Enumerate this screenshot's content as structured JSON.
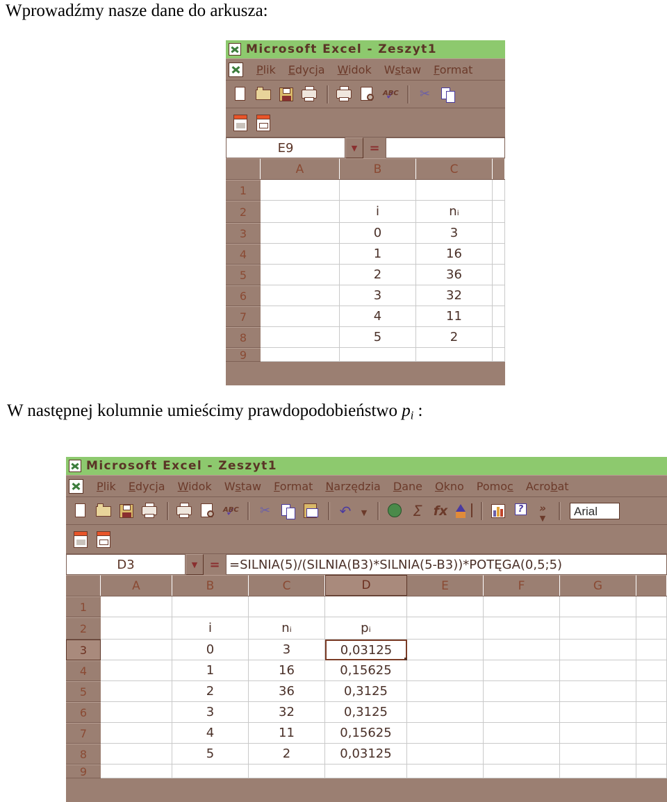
{
  "document": {
    "intro_text_before": "Wprowadźmy nasze dane do arkusza:",
    "second_text_before": "W następnej kolumnie umieścimy prawdopodobieństwo ",
    "second_text_symbol": "p",
    "second_text_symbol_sub": "i",
    "second_text_after": " :"
  },
  "colors": {
    "titlebar": "#8dc96e",
    "chrome": "#9b7f72",
    "chrome_dark": "#7d6055",
    "chrome_light": "#b79e92",
    "header_text": "#8a4a33",
    "cell_text": "#4a3028",
    "selection": "#7a3b26"
  },
  "window1": {
    "title": "Microsoft Excel - Zeszyt1",
    "logo_icon": "excel-logo-icon",
    "menu": [
      "Plik",
      "Edycja",
      "Widok",
      "Wstaw",
      "Format"
    ],
    "toolbar_icons": [
      "new-document-icon",
      "open-folder-icon",
      "save-disk-icon",
      "print-to-file-icon",
      "print-icon",
      "print-preview-icon",
      "spellcheck-icon",
      "cut-scissors-icon",
      "copy-icon"
    ],
    "toolbar2_icons": [
      "pdf-convert-icon",
      "pdf-settings-icon"
    ],
    "name_box": "E9",
    "equals_sign": "=",
    "formula": "",
    "dropdown_icon": "chevron-down-icon",
    "columns": [
      "A",
      "B",
      "C"
    ],
    "rows": [
      "1",
      "2",
      "3",
      "4",
      "5",
      "6",
      "7",
      "8",
      "9"
    ],
    "grid": [
      [
        "",
        "",
        ""
      ],
      [
        "",
        "i",
        "nᵢ"
      ],
      [
        "",
        "0",
        "3"
      ],
      [
        "",
        "1",
        "16"
      ],
      [
        "",
        "2",
        "36"
      ],
      [
        "",
        "3",
        "32"
      ],
      [
        "",
        "4",
        "11"
      ],
      [
        "",
        "5",
        "2"
      ],
      [
        "",
        "",
        ""
      ]
    ]
  },
  "window2": {
    "title": "Microsoft Excel - Zeszyt1",
    "logo_icon": "excel-logo-icon",
    "menu": [
      "Plik",
      "Edycja",
      "Widok",
      "Wstaw",
      "Format",
      "Narzędzia",
      "Dane",
      "Okno",
      "Pomoc",
      "Acrobat"
    ],
    "toolbar_icons": [
      "new-document-icon",
      "open-folder-icon",
      "save-disk-icon",
      "print-to-file-icon",
      "print-icon",
      "print-preview-icon",
      "spellcheck-icon",
      "cut-scissors-icon",
      "copy-icon",
      "paste-icon",
      "undo-icon",
      "undo-dropdown-icon",
      "web-globe-icon",
      "autosum-icon",
      "function-fx-icon",
      "sort-ascending-icon",
      "chart-wizard-icon",
      "help-icon",
      "more-buttons-icon"
    ],
    "toolbar2_icons": [
      "pdf-convert-icon",
      "pdf-settings-icon"
    ],
    "font_name": "Arial",
    "sigma_symbol": "Σ",
    "fx_symbol": "fx",
    "help_symbol": "?",
    "more_symbol": "»",
    "name_box": "D3",
    "equals_sign": "=",
    "formula": "=SILNIA(5)/(SILNIA(B3)*SILNIA(5-B3))*POTĘGA(0,5;5)",
    "dropdown_icon": "chevron-down-icon",
    "columns": [
      "A",
      "B",
      "C",
      "D",
      "E",
      "F",
      "G"
    ],
    "selected_column": "D",
    "rows": [
      "1",
      "2",
      "3",
      "4",
      "5",
      "6",
      "7",
      "8",
      "9"
    ],
    "selected_row": "3",
    "active_cell": "D3",
    "grid": [
      [
        "",
        "",
        "",
        "",
        "",
        "",
        ""
      ],
      [
        "",
        "i",
        "nᵢ",
        "pᵢ",
        "",
        "",
        ""
      ],
      [
        "",
        "0",
        "3",
        "0,03125",
        "",
        "",
        ""
      ],
      [
        "",
        "1",
        "16",
        "0,15625",
        "",
        "",
        ""
      ],
      [
        "",
        "2",
        "36",
        "0,3125",
        "",
        "",
        ""
      ],
      [
        "",
        "3",
        "32",
        "0,3125",
        "",
        "",
        ""
      ],
      [
        "",
        "4",
        "11",
        "0,15625",
        "",
        "",
        ""
      ],
      [
        "",
        "5",
        "2",
        "0,03125",
        "",
        "",
        ""
      ],
      [
        "",
        "",
        "",
        "",
        "",
        "",
        ""
      ]
    ]
  }
}
